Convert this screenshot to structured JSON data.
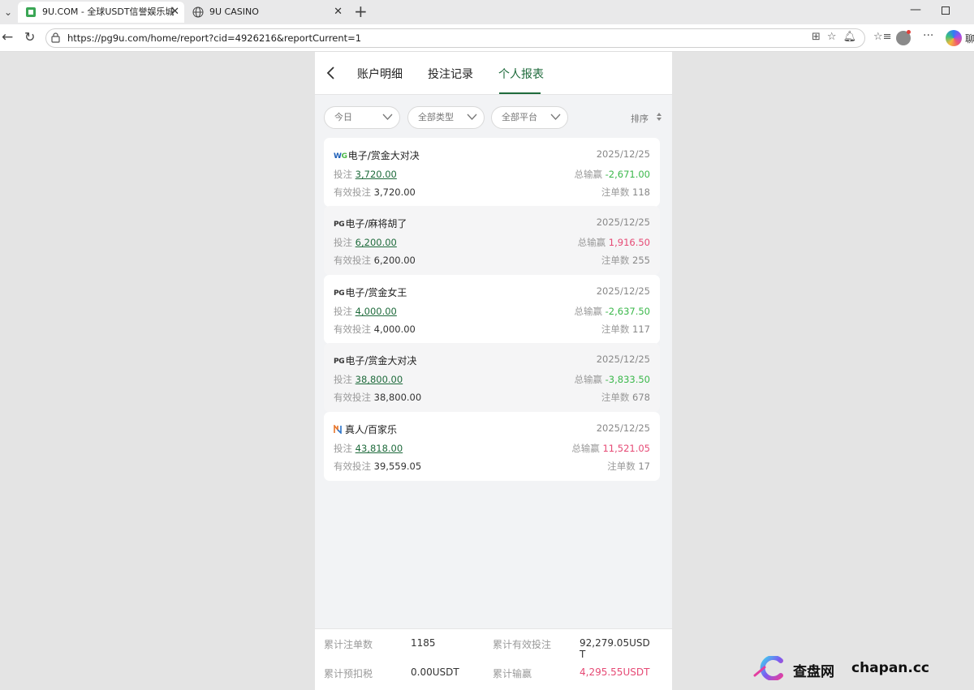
{
  "browser": {
    "tabs": [
      {
        "title": "9U.COM - 全球USDT信誉娱乐城",
        "active": true
      },
      {
        "title": "9U CASINO",
        "active": false
      }
    ],
    "url": "https://pg9u.com/home/report?cid=4926216&reportCurrent=1"
  },
  "nav": {
    "tabs": [
      "账户明细",
      "投注记录",
      "个人报表"
    ],
    "active_tab": "个人报表"
  },
  "filters": {
    "date": "今日",
    "type": "全部类型",
    "platform": "全部平台",
    "sort_label": "排序"
  },
  "labels": {
    "bet": "投注",
    "valid_bet": "有效投注",
    "total_win": "总输赢",
    "bet_count": "注单数"
  },
  "records": [
    {
      "platform": "WG",
      "game": "电子/赏金大对决",
      "date": "2025/12/25",
      "bet": "3,720.00",
      "valid_bet": "3,720.00",
      "total_win": "-2,671.00",
      "count": "118"
    },
    {
      "platform": "PG",
      "game": "电子/麻将胡了",
      "date": "2025/12/25",
      "bet": "6,200.00",
      "valid_bet": "6,200.00",
      "total_win": "1,916.50",
      "count": "255"
    },
    {
      "platform": "PG",
      "game": "电子/赏金女王",
      "date": "2025/12/25",
      "bet": "4,000.00",
      "valid_bet": "4,000.00",
      "total_win": "-2,637.50",
      "count": "117"
    },
    {
      "platform": "PG",
      "game": "电子/赏金大对决",
      "date": "2025/12/25",
      "bet": "38,800.00",
      "valid_bet": "38,800.00",
      "total_win": "-3,833.50",
      "count": "678"
    },
    {
      "platform": "EVO",
      "game": "真人/百家乐",
      "date": "2025/12/25",
      "bet": "43,818.00",
      "valid_bet": "39,559.05",
      "total_win": "11,521.05",
      "count": "17"
    }
  ],
  "summary": {
    "total_count_label": "累计注单数",
    "total_count": "1185",
    "total_valid_label": "累计有效投注",
    "total_valid": "92,279.05USDT",
    "tax_label": "累计预扣税",
    "tax": "0.00USDT",
    "total_win_label": "累计输赢",
    "total_win": "4,295.55USDT"
  },
  "colors": {
    "accent": "#1f6b3c",
    "loss": "#3bb84b",
    "gain": "#e64a75"
  },
  "watermark": {
    "cn": "查盘网",
    "en": "chapan.cc"
  }
}
